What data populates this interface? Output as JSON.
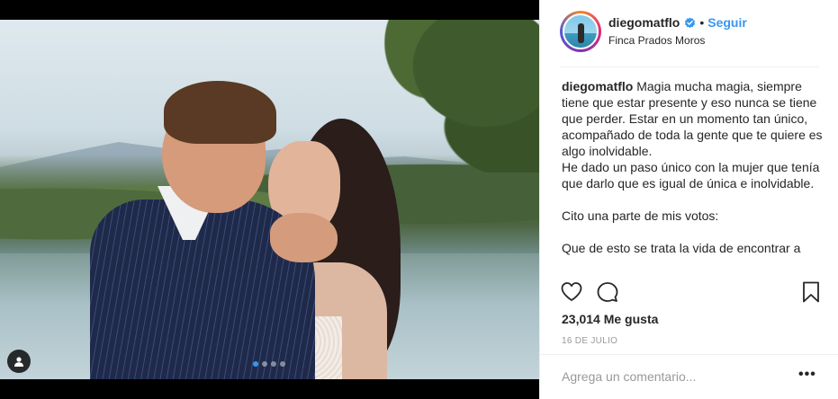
{
  "post": {
    "username": "diegomatflo",
    "verified": true,
    "separator": "•",
    "follow_label": "Seguir",
    "location": "Finca Prados Moros",
    "caption_lines": [
      "Magia mucha magia, siempre tiene que estar presente y eso nunca se tiene que perder. Estar en un momento tan único, acompañado de toda la gente que te quiere es algo inolvidable.",
      "He dado un paso único con la mujer que tenía que darlo que es igual de única e inolvidable.",
      "Cito una parte de mis votos:",
      "Que de esto se trata la vida de encontrar a"
    ],
    "likes": "23,014 Me gusta",
    "date": "16 DE JULIO",
    "comment_placeholder": "Agrega un comentario...",
    "more_label": "•••"
  },
  "media": {
    "carousel_slides": 4,
    "carousel_active": 0
  },
  "icons": {
    "like": "heart-icon",
    "comment": "comment-bubble-icon",
    "save": "bookmark-icon",
    "tag": "user-tag-icon",
    "verified": "verified-badge-icon"
  },
  "colors": {
    "accent": "#3897f0",
    "muted": "#999999",
    "text": "#262626"
  }
}
